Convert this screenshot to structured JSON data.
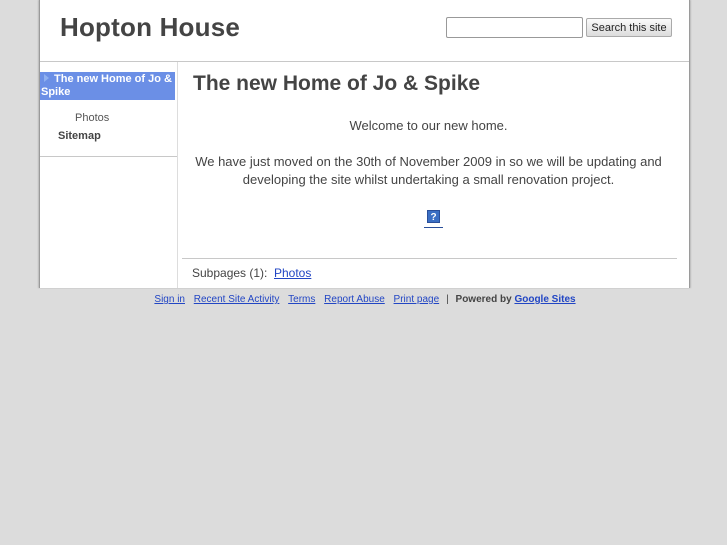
{
  "header": {
    "site_title": "Hopton House",
    "search_placeholder": "",
    "search_button": "Search this site"
  },
  "sidebar": {
    "active_item": "The new Home of Jo & Spike",
    "sub_item": "Photos",
    "sitemap": "Sitemap"
  },
  "main": {
    "title": "The new Home of Jo & Spike",
    "welcome": "Welcome to our new home.",
    "paragraph": "We have just moved on the 30th of November 2009 in so we will be updating and developing the site whilst undertaking a small renovation project.",
    "image_placeholder": "?",
    "subpages_label": "Subpages (1):",
    "subpages_link": "Photos"
  },
  "footer": {
    "sign_in": "Sign in",
    "recent_activity": "Recent Site Activity",
    "terms": "Terms",
    "report_abuse": "Report Abuse",
    "print_page": "Print page",
    "separator": "|",
    "powered_by": "Powered by",
    "google_sites": "Google Sites"
  },
  "colors": {
    "active_nav": "#6b8fe6",
    "link": "#2246c4",
    "background": "#dcdcdc"
  }
}
